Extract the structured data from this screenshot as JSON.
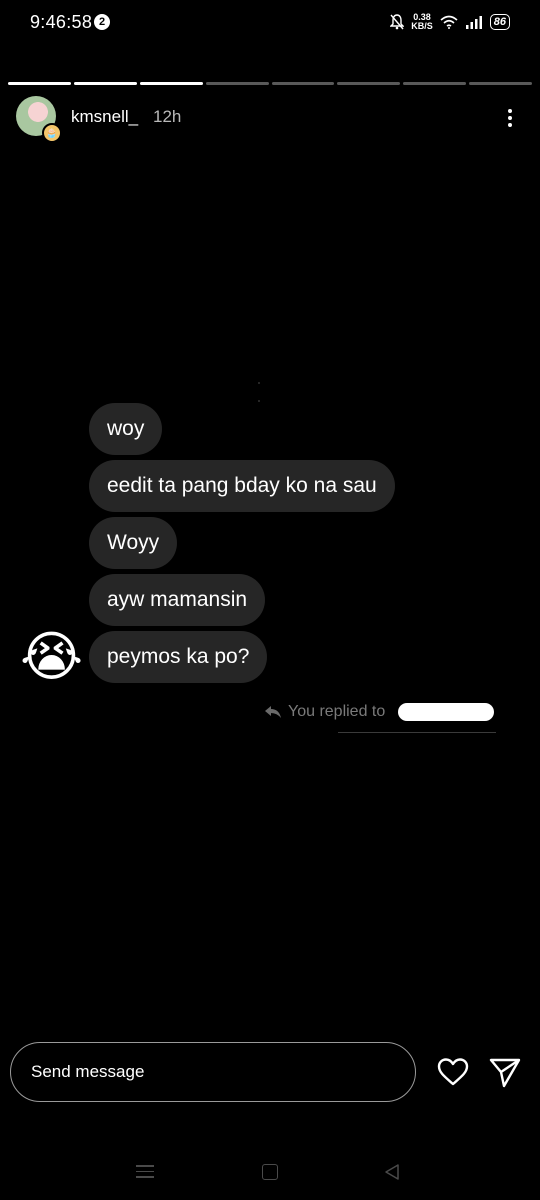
{
  "status_bar": {
    "time": "9:46:58",
    "notification_count": "2",
    "net_speed_value": "0.38",
    "net_speed_unit": "KB/S",
    "battery": "86"
  },
  "story": {
    "segments_total": 8,
    "segments_viewed": 3,
    "username": "kmsnell_",
    "time_ago": "12h"
  },
  "messages": [
    {
      "text": "woy"
    },
    {
      "text": "eedit ta pang bday ko na sau"
    },
    {
      "text": "Woyy"
    },
    {
      "text": "ayw mamansin"
    },
    {
      "text": "peymos ka po?"
    }
  ],
  "reaction_emoji": "😭",
  "reply_note": "You replied to",
  "composer": {
    "placeholder": "Send message"
  },
  "colors": {
    "background": "#000000",
    "bubble": "#262626",
    "muted_text": "#7a7a7a"
  },
  "icons": [
    "more-options-icon",
    "reply-arrow-icon",
    "heart-icon",
    "send-icon",
    "recents-icon",
    "home-icon",
    "back-icon"
  ]
}
